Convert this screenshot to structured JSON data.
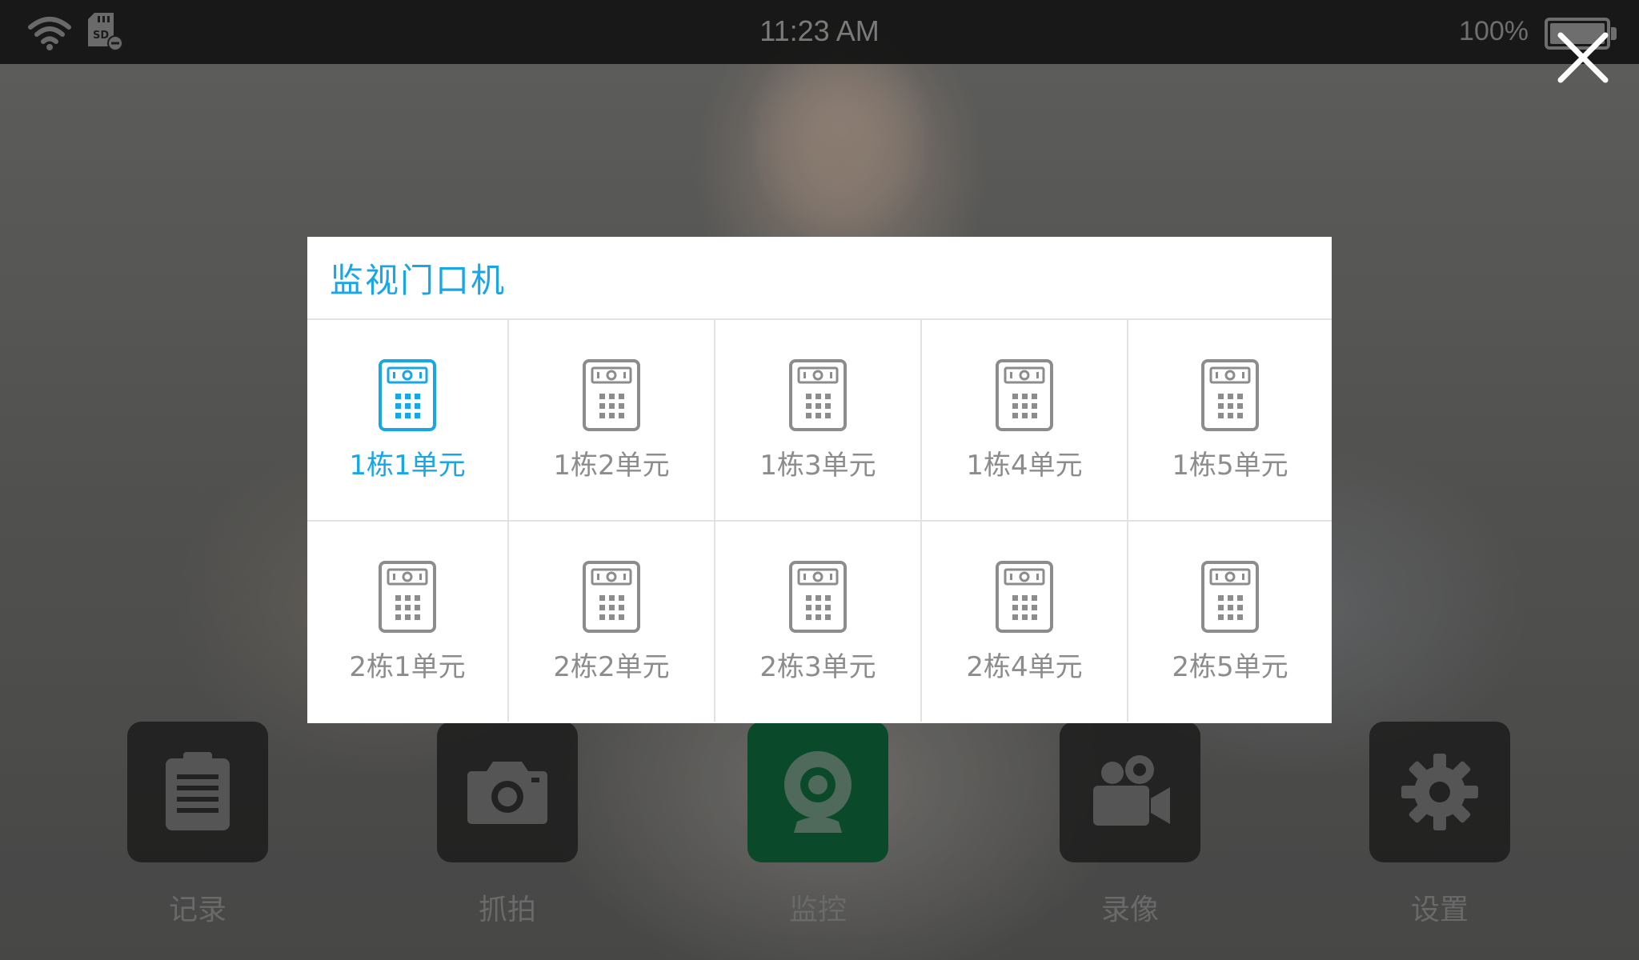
{
  "status_bar": {
    "time": "11:23 AM",
    "battery": "100%",
    "icons": [
      "wifi-icon",
      "sd-card-icon",
      "battery-icon"
    ]
  },
  "close_icon": "close-icon",
  "dialog": {
    "title": "监视门口机",
    "selected_index": 0,
    "accent_color": "#1aa6e6",
    "units": [
      {
        "label": "1栋1单元"
      },
      {
        "label": "1栋2单元"
      },
      {
        "label": "1栋3单元"
      },
      {
        "label": "1栋4单元"
      },
      {
        "label": "1栋5单元"
      },
      {
        "label": "2栋1单元"
      },
      {
        "label": "2栋2单元"
      },
      {
        "label": "2栋3单元"
      },
      {
        "label": "2栋4单元"
      },
      {
        "label": "2栋5单元"
      }
    ]
  },
  "dock": {
    "items": [
      {
        "label": "记录",
        "icon": "clipboard-icon"
      },
      {
        "label": "抓拍",
        "icon": "camera-icon"
      },
      {
        "label": "监控",
        "icon": "webcam-icon",
        "active": true
      },
      {
        "label": "录像",
        "icon": "video-camera-icon"
      },
      {
        "label": "设置",
        "icon": "gear-icon"
      }
    ]
  }
}
